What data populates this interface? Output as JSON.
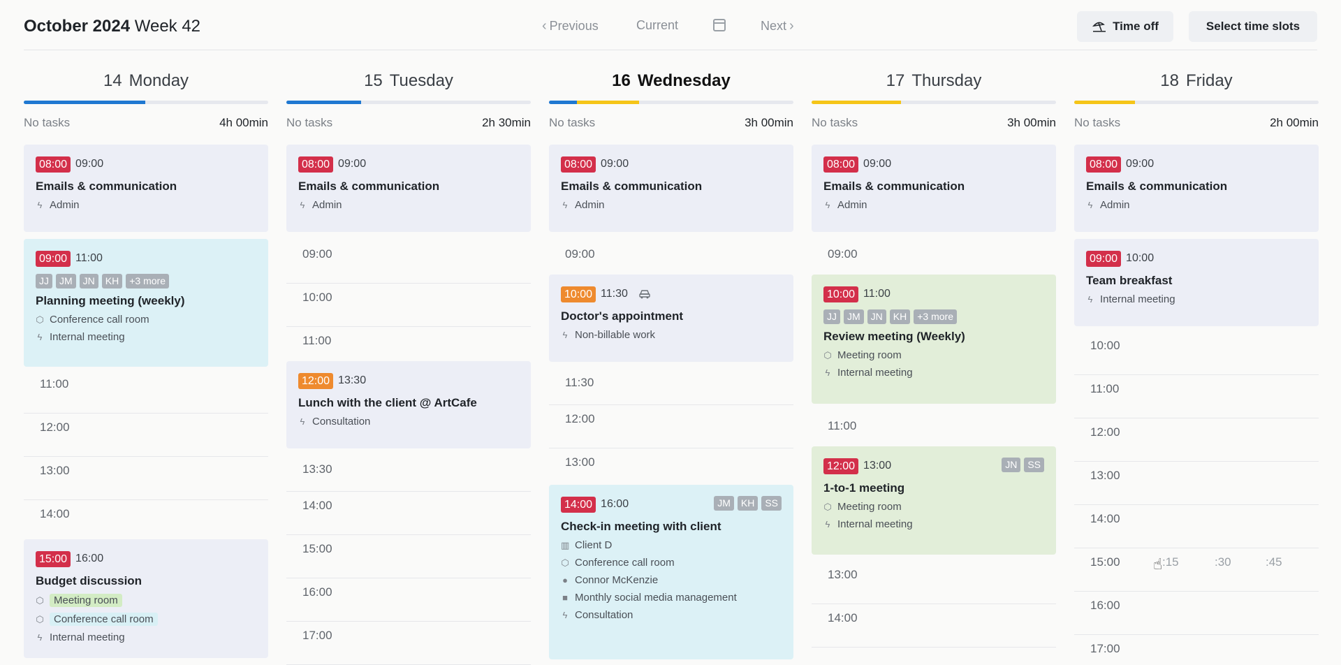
{
  "header": {
    "month_year": "October 2024",
    "week": "Week 42",
    "prev_label": "Previous",
    "current_label": "Current",
    "next_label": "Next",
    "time_off_label": "Time off",
    "select_slots_label": "Select time slots"
  },
  "colors": {
    "red": "#d32f4a",
    "orange": "#ee8a2e",
    "blue_bar": "#1f78d1",
    "yellow_bar": "#f5c518"
  },
  "days": [
    {
      "num": "14",
      "name": "Monday",
      "no_tasks": "No tasks",
      "total": "4h 00min",
      "events": [
        {
          "start": "08:00",
          "end": "09:00",
          "title": "Emails & communication",
          "type": "Admin"
        },
        {
          "start": "09:00",
          "end": "11:00",
          "avatars": [
            "JJ",
            "JM",
            "JN",
            "KH",
            "+3 more"
          ],
          "title": "Planning meeting (weekly)",
          "room": "Conference call room",
          "type": "Internal meeting"
        },
        {
          "start": "15:00",
          "end": "16:00",
          "title": "Budget discussion",
          "room1": "Meeting room",
          "room2": "Conference call room",
          "type": "Internal meeting"
        }
      ],
      "slots": [
        "11:00",
        "12:00",
        "13:00",
        "14:00"
      ]
    },
    {
      "num": "15",
      "name": "Tuesday",
      "no_tasks": "No tasks",
      "total": "2h 30min",
      "events": [
        {
          "start": "08:00",
          "end": "09:00",
          "title": "Emails & communication",
          "type": "Admin"
        },
        {
          "start": "12:00",
          "end": "13:30",
          "title": "Lunch with the client @ ArtCafe",
          "type": "Consultation"
        }
      ],
      "slots": [
        "09:00",
        "10:00",
        "11:00",
        "13:30",
        "14:00",
        "15:00",
        "16:00",
        "17:00"
      ]
    },
    {
      "num": "16",
      "name": "Wednesday",
      "no_tasks": "No tasks",
      "total": "3h 00min",
      "events": [
        {
          "start": "08:00",
          "end": "09:00",
          "title": "Emails & communication",
          "type": "Admin"
        },
        {
          "start": "10:00",
          "end": "11:30",
          "title": "Doctor's appointment",
          "type": "Non-billable work"
        },
        {
          "start": "14:00",
          "end": "16:00",
          "avatars": [
            "JM",
            "KH",
            "SS"
          ],
          "title": "Check-in meeting with client",
          "client": "Client D",
          "room": "Conference call room",
          "person": "Connor McKenzie",
          "project": "Monthly social media management",
          "type": "Consultation"
        }
      ],
      "slots": [
        "09:00",
        "11:30",
        "12:00",
        "13:00"
      ]
    },
    {
      "num": "17",
      "name": "Thursday",
      "no_tasks": "No tasks",
      "total": "3h 00min",
      "events": [
        {
          "start": "08:00",
          "end": "09:00",
          "title": "Emails & communication",
          "type": "Admin"
        },
        {
          "start": "10:00",
          "end": "11:00",
          "avatars": [
            "JJ",
            "JM",
            "JN",
            "KH",
            "+3 more"
          ],
          "title": "Review meeting (Weekly)",
          "room": "Meeting room",
          "type": "Internal meeting"
        },
        {
          "start": "12:00",
          "end": "13:00",
          "avatars": [
            "JN",
            "SS"
          ],
          "title": "1-to-1 meeting",
          "room": "Meeting room",
          "type": "Internal meeting"
        }
      ],
      "slots": [
        "09:00",
        "11:00",
        "13:00",
        "14:00"
      ]
    },
    {
      "num": "18",
      "name": "Friday",
      "no_tasks": "No tasks",
      "total": "2h 00min",
      "events": [
        {
          "start": "08:00",
          "end": "09:00",
          "title": "Emails & communication",
          "type": "Admin"
        },
        {
          "start": "09:00",
          "end": "10:00",
          "title": "Team breakfast",
          "type": "Internal meeting"
        }
      ],
      "slots": [
        "10:00",
        "11:00",
        "12:00",
        "13:00",
        "14:00",
        "15:00",
        "16:00",
        "17:00"
      ],
      "quarters": [
        ":15",
        ":30",
        ":45"
      ]
    }
  ]
}
